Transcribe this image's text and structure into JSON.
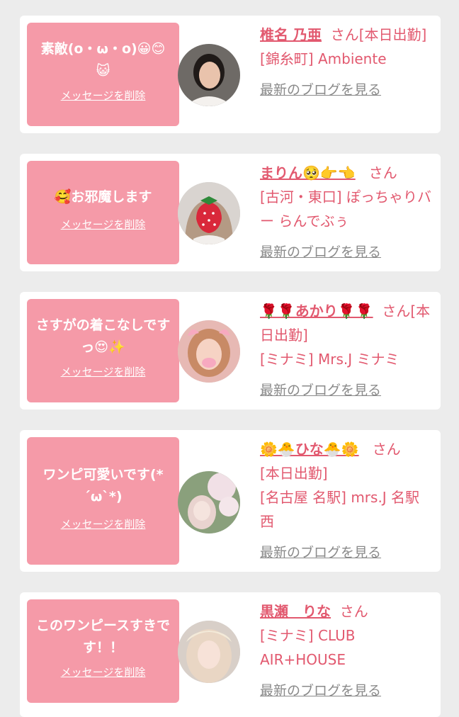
{
  "cards": [
    {
      "message": "素敵(o・ω・o)😀😊😺",
      "delete_label": "メッセージを削除",
      "name": "椎名 乃亜",
      "san": "さん",
      "status": "[本日出勤]",
      "shop": "[錦糸町] Ambiente",
      "blog_label": "最新のブログを見る"
    },
    {
      "message": "🥰お邪魔します",
      "delete_label": "メッセージを削除",
      "name": "まりん🥺👉👈",
      "san": "さん",
      "status": "",
      "shop": "[古河・東口] ぽっちゃりバー らんでぶぅ",
      "blog_label": "最新のブログを見る"
    },
    {
      "message": "さすがの着こなしですっ😍✨",
      "delete_label": "メッセージを削除",
      "name": "🌹🌹あかり🌹🌹",
      "san": "さん",
      "status": "[本日出勤]",
      "shop": "[ミナミ] Mrs.J ミナミ",
      "blog_label": "最新のブログを見る"
    },
    {
      "message": "ワンピ可愛いです(*´ω`*)",
      "delete_label": "メッセージを削除",
      "name": "🌼🐣ひな🐣🌼",
      "san": "さん",
      "status": "[本日出勤]",
      "shop": "[名古屋 名駅] mrs.J 名駅西",
      "blog_label": "最新のブログを見る"
    },
    {
      "message": "このワンピースすきです！！",
      "delete_label": "メッセージを削除",
      "name": "黒瀬　りな",
      "san": "さん",
      "status": "",
      "shop": "[ミナミ] CLUB AIR+HOUSE",
      "blog_label": "最新のブログを見る"
    }
  ]
}
